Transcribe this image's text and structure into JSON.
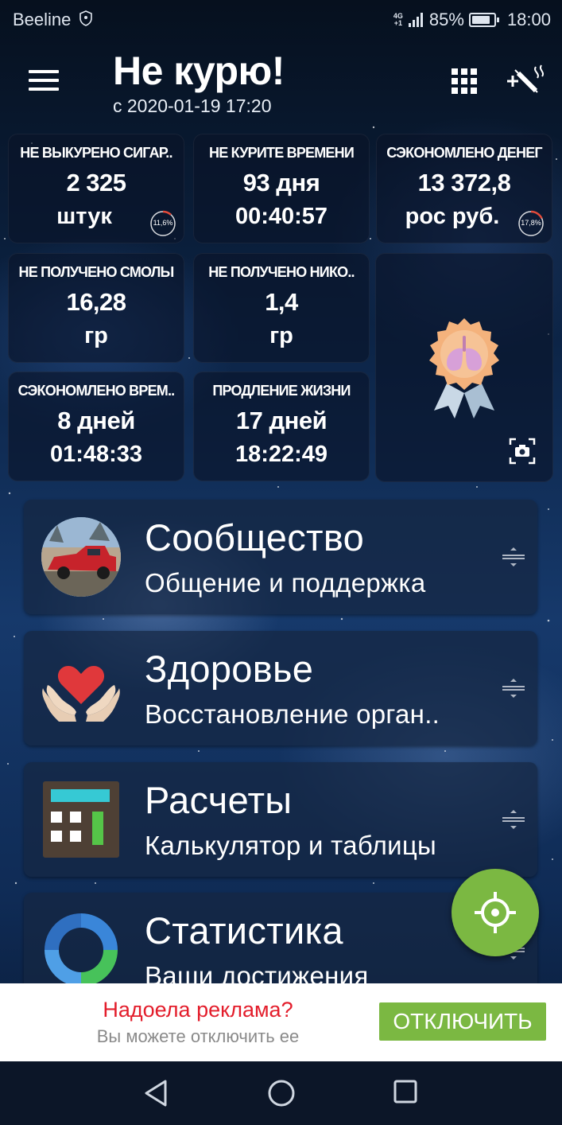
{
  "status_bar": {
    "carrier": "Beeline",
    "network": [
      "4G",
      "+1"
    ],
    "battery_percent": "85%",
    "battery_level": 0.85,
    "time": "18:00"
  },
  "header": {
    "title": "Не курю!",
    "subtitle": "с 2020-01-19 17:20",
    "menu_icon": "hamburger-menu-icon",
    "grid_icon": "grid-icon",
    "cigarette_icon": "add-cigarette-icon"
  },
  "stats": [
    {
      "label": "НЕ ВЫКУРЕНО СИГАР..",
      "value": "2 325",
      "unit": "штук",
      "progress_label": "11,6%",
      "progress": 0.116
    },
    {
      "label": "НЕ КУРИТЕ ВРЕМЕНИ",
      "value": "93 дня",
      "unit": "00:40:57"
    },
    {
      "label": "СЭКОНОМЛЕНО ДЕНЕГ",
      "value": "13 372,8",
      "unit": "рос руб.",
      "progress_label": "17,8%",
      "progress": 0.178
    },
    {
      "label": "НЕ ПОЛУЧЕНО СМОЛЫ",
      "value": "16,28",
      "unit": "гр"
    },
    {
      "label": "НЕ ПОЛУЧЕНО НИКО..",
      "value": "1,4",
      "unit": "гр"
    },
    {
      "label": "СЭКОНОМЛЕНО ВРЕМ..",
      "value": "8 дней",
      "unit": "01:48:33"
    },
    {
      "label": "ПРОДЛЕНИЕ ЖИЗНИ",
      "value": "17 дней",
      "unit": "18:22:49"
    }
  ],
  "achievement": {
    "icon": "lungs-medal-icon",
    "camera_icon": "camera-icon"
  },
  "menu": [
    {
      "title": "Сообщество",
      "subtitle": "Общение и поддержка",
      "icon": "community-avatar"
    },
    {
      "title": "Здоровье",
      "subtitle": "Восстановление орган..",
      "icon": "heart-hands-icon"
    },
    {
      "title": "Расчеты",
      "subtitle": "Калькулятор и таблицы",
      "icon": "calculator-icon"
    },
    {
      "title": "Статистика",
      "subtitle": "Ваши достижения",
      "icon": "statistics-icon"
    }
  ],
  "fab": {
    "icon": "crosshair-icon"
  },
  "ad": {
    "title": "Надоела реклама?",
    "subtitle": "Вы можете отключить ее",
    "button": "ОТКЛЮЧИТЬ"
  },
  "navbar": {
    "back_icon": "back-icon",
    "home_icon": "home-icon",
    "recent_icon": "recent-apps-icon"
  },
  "colors": {
    "accent_green": "#7bb842",
    "ad_red": "#e31d2b",
    "ring_red": "#e34a3a"
  }
}
